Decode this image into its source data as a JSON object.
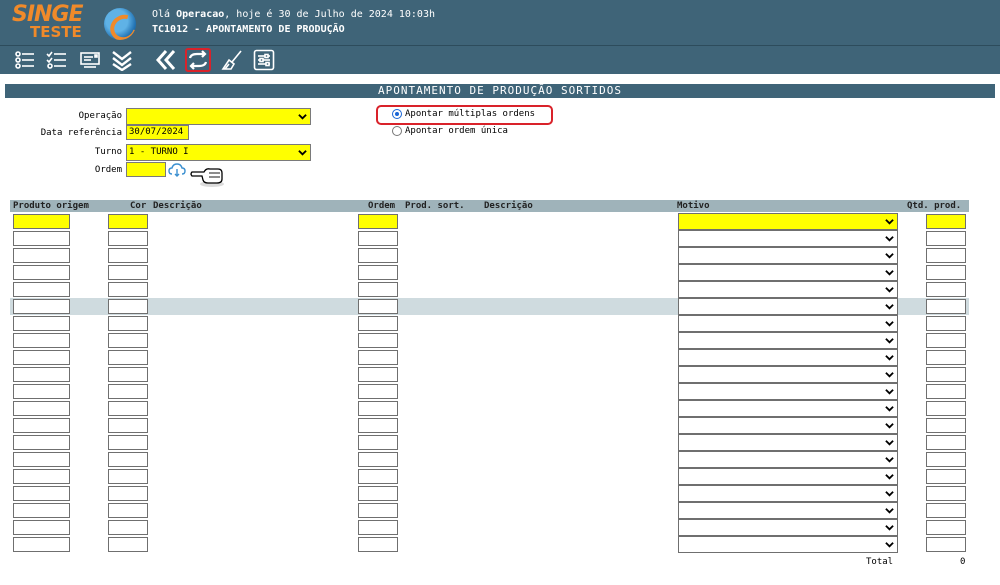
{
  "app": {
    "logo_text": "SINGE",
    "logo_sub": "TESTE",
    "greeting_prefix": "Olá ",
    "user": "Operacao",
    "greeting_suffix": ", hoje é 30 de Julho de 2024 10:03h",
    "screen_title": "TC1012 - APONTAMENTO DE PRODUÇÃO"
  },
  "toolbar": {
    "icons": [
      "list-icon",
      "checklist-icon",
      "print-icon",
      "collapse-icon",
      "back-icon",
      "refresh-icon",
      "broom-icon",
      "settings-icon"
    ]
  },
  "section_title": "APONTAMENTO DE PRODUÇÃO SORTIDOS",
  "form": {
    "operacao_label": "Operação",
    "operacao_value": "",
    "data_label": "Data referência",
    "data_value": "30/07/2024",
    "turno_label": "Turno",
    "turno_value": "1 - TURNO I",
    "ordem_label": "Ordem",
    "ordem_value": ""
  },
  "mode": {
    "option1": "Apontar múltiplas ordens",
    "option2": "Apontar ordem única",
    "selected": "option1"
  },
  "grid": {
    "headers": {
      "produto_origem": "Produto origem",
      "cor": "Cor",
      "descricao1": "Descrição",
      "ordem": "Ordem",
      "prod_sort": "Prod. sort.",
      "descricao2": "Descrição",
      "motivo": "Motivo",
      "qtd_prod": "Qtd. prod."
    },
    "row_count": 20
  },
  "footer": {
    "total_label": "Total",
    "total_value": "0"
  },
  "colors": {
    "header_bg": "#3f6478",
    "input_yellow": "#ffff00",
    "highlight_red": "#d9222a",
    "grid_header": "#9fb3ba"
  }
}
